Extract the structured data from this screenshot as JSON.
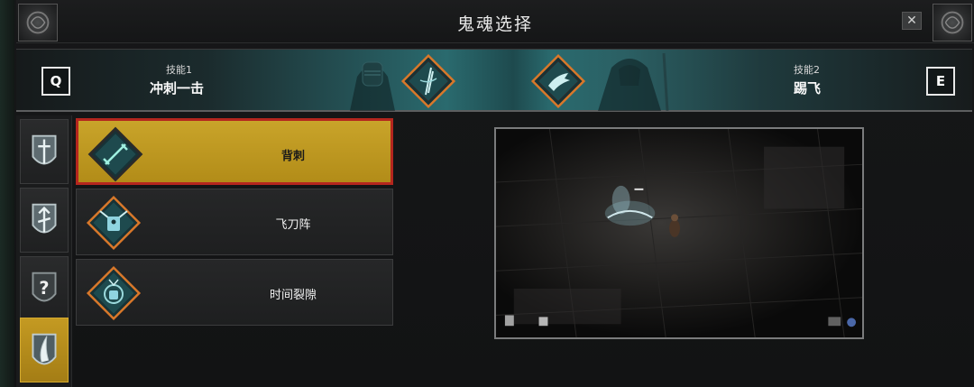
{
  "window": {
    "title": "鬼魂选择",
    "close_symbol": "✕"
  },
  "banner": {
    "skill1": {
      "key": "Q",
      "label": "技能1",
      "name": "冲刺一击",
      "icon": "dash-strike-icon"
    },
    "skill2": {
      "key": "E",
      "label": "技能2",
      "name": "踢飞",
      "icon": "kick-icon"
    }
  },
  "sidebar": {
    "tabs": [
      {
        "icon": "knight-crest-icon",
        "active": false
      },
      {
        "icon": "arrow-crest-icon",
        "active": false
      },
      {
        "icon": "unknown-crest-icon",
        "glyph": "?",
        "active": false
      },
      {
        "icon": "blade-crest-icon",
        "active": true
      }
    ]
  },
  "abilities": [
    {
      "name": "背刺",
      "icon": "backstab-icon",
      "selected": true
    },
    {
      "name": "飞刀阵",
      "icon": "flying-knives-icon",
      "selected": false
    },
    {
      "name": "时间裂隙",
      "icon": "time-rift-icon",
      "selected": false
    }
  ],
  "colors": {
    "accent_gold": "#c9a42a",
    "selected_border": "#b4261e",
    "diamond_orange": "#d9782a",
    "teal": "#2a6a6e"
  }
}
